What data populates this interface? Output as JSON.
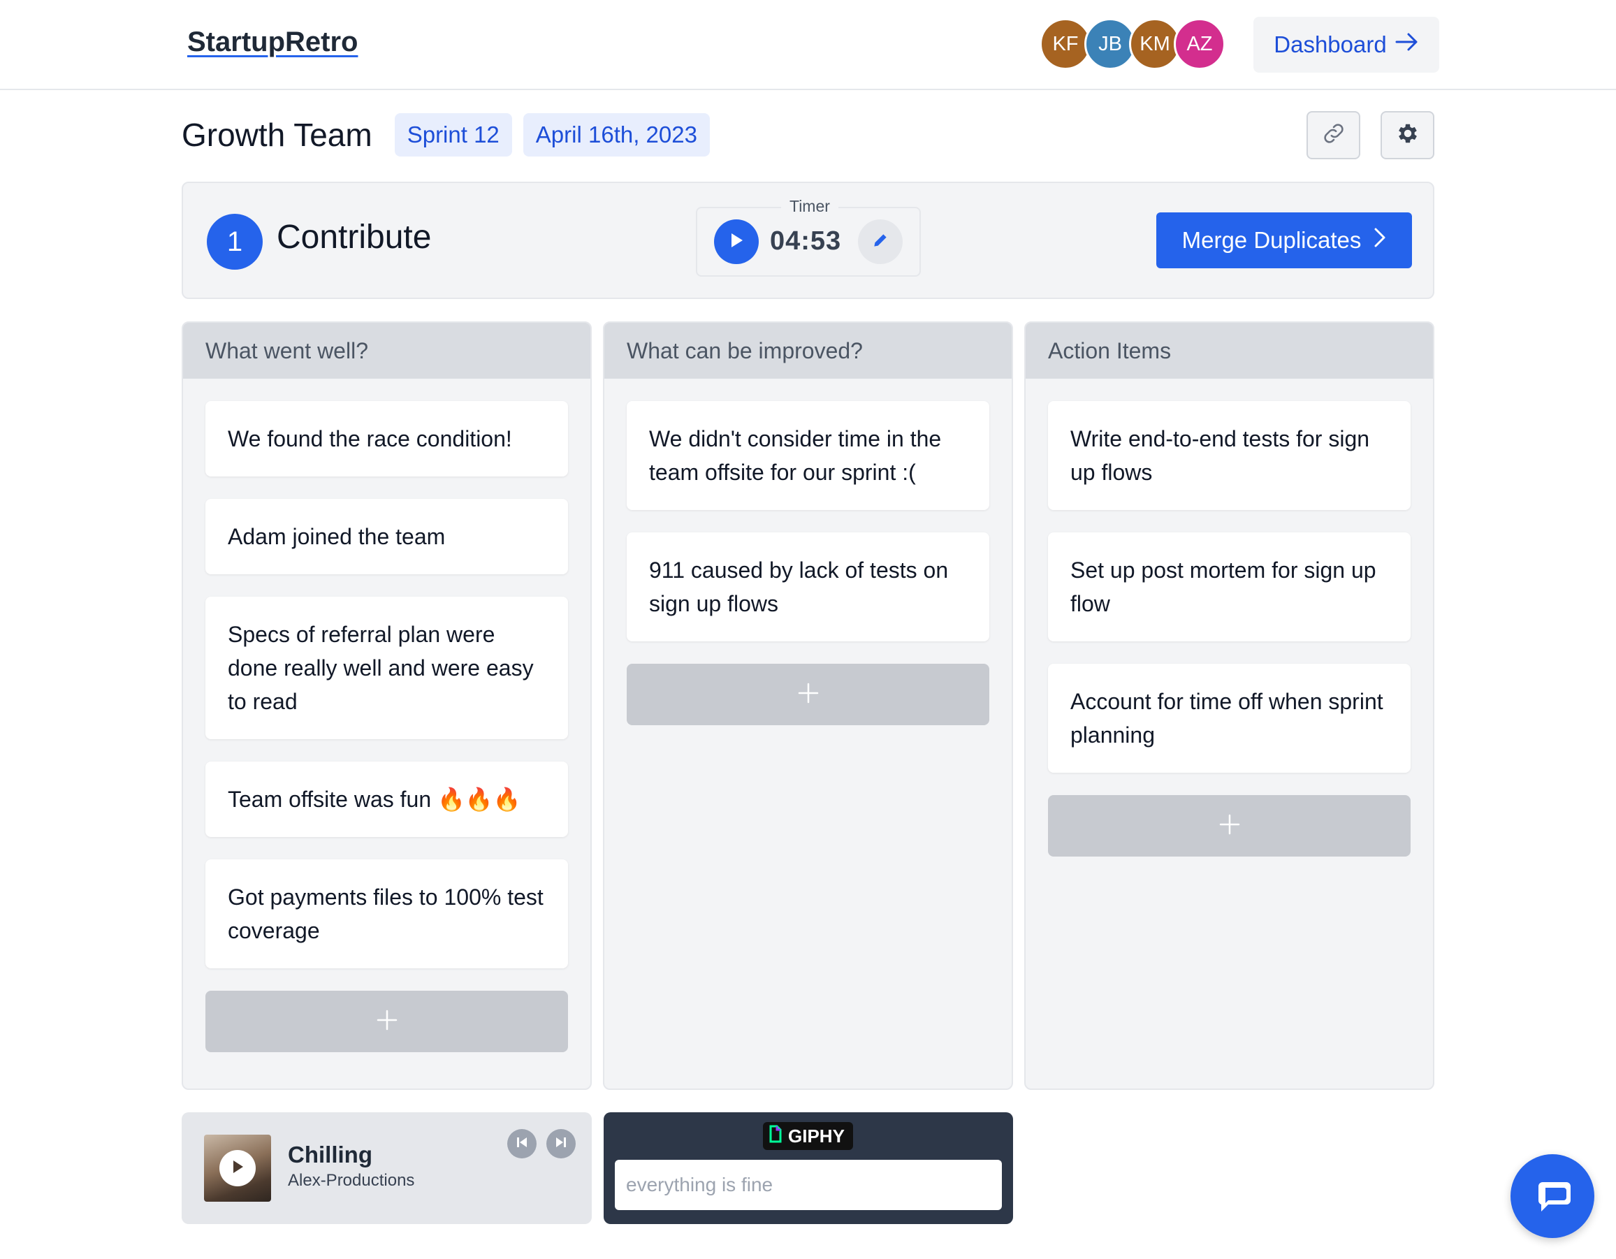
{
  "header": {
    "logo": "StartupRetro",
    "avatars": [
      {
        "initials": "KF",
        "color": "#a66321"
      },
      {
        "initials": "JB",
        "color": "#3b82b7"
      },
      {
        "initials": "KM",
        "color": "#a66321"
      },
      {
        "initials": "AZ",
        "color": "#d32e8e"
      }
    ],
    "dashboard_label": "Dashboard"
  },
  "board": {
    "team": "Growth Team",
    "sprint": "Sprint 12",
    "date": "April 16th, 2023"
  },
  "stage": {
    "number": "1",
    "name": "Contribute",
    "timer_label": "Timer",
    "timer_value": "04:53",
    "merge_label": "Merge Duplicates"
  },
  "columns": [
    {
      "title": "What went well?",
      "cards": [
        "We found the race condition!",
        "Adam joined the team",
        "Specs of referral plan were done really well and were easy to read",
        "Team offsite was fun 🔥🔥🔥",
        "Got payments files to 100% test coverage"
      ]
    },
    {
      "title": "What can be improved?",
      "cards": [
        "We didn't consider time in the team offsite for our sprint :(",
        "911 caused by lack of tests on sign up flows"
      ]
    },
    {
      "title": "Action Items",
      "cards": [
        "Write end-to-end tests for sign up flows",
        "Set up post mortem for sign up flow",
        "Account for time off when sprint planning"
      ]
    }
  ],
  "player": {
    "title": "Chilling",
    "artist": "Alex-Productions"
  },
  "giphy": {
    "logo_text": "GIPHY",
    "placeholder": "everything is fine"
  },
  "colors": {
    "accent": "#2563eb",
    "accent_text": "#1d4ed8",
    "column_bg": "#f3f4f6",
    "column_header_bg": "#d9dce1"
  }
}
